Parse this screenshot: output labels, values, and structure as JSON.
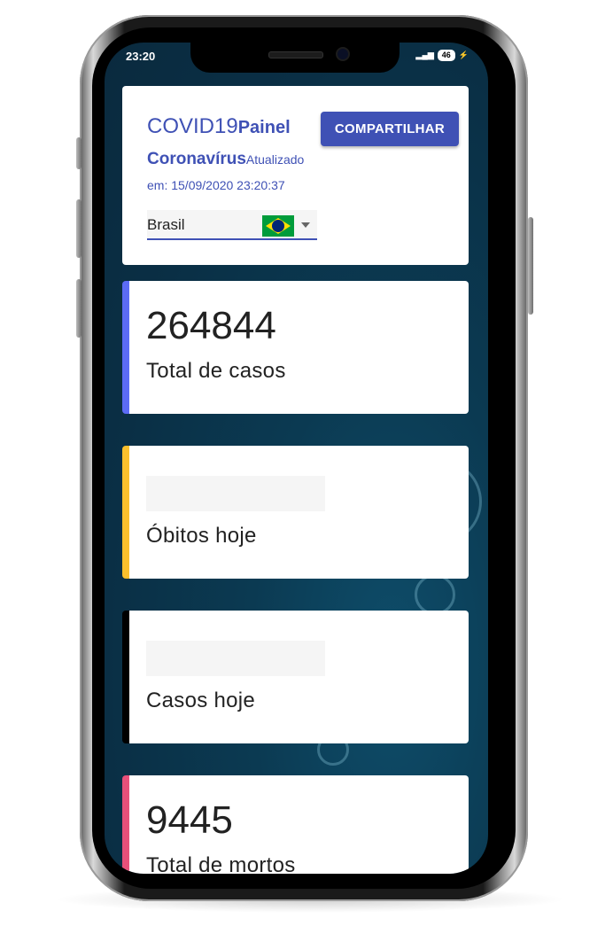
{
  "status_bar": {
    "time": "23:20",
    "battery": "46"
  },
  "header": {
    "title_main": "COVID19",
    "title_small": "Painel",
    "subtitle": "Coronavírus",
    "updated_label": "Atualizado",
    "updated_date": "em: 15/09/2020 23:20:37",
    "share_label": "COMPARTILHAR",
    "country": "Brasil"
  },
  "stats": [
    {
      "value": "264844",
      "label": "Total de casos",
      "color": "#5c6bf5"
    },
    {
      "value": "",
      "label": "Óbitos hoje",
      "color": "#fbc02d"
    },
    {
      "value": "",
      "label": "Casos hoje",
      "color": "#000000"
    },
    {
      "value": "9445",
      "label": "Total de mortos",
      "color": "#e8507a"
    }
  ],
  "icons": [
    "brazil-flag-icon",
    "dropdown-arrow-icon",
    "signal-icon",
    "charging-icon"
  ]
}
